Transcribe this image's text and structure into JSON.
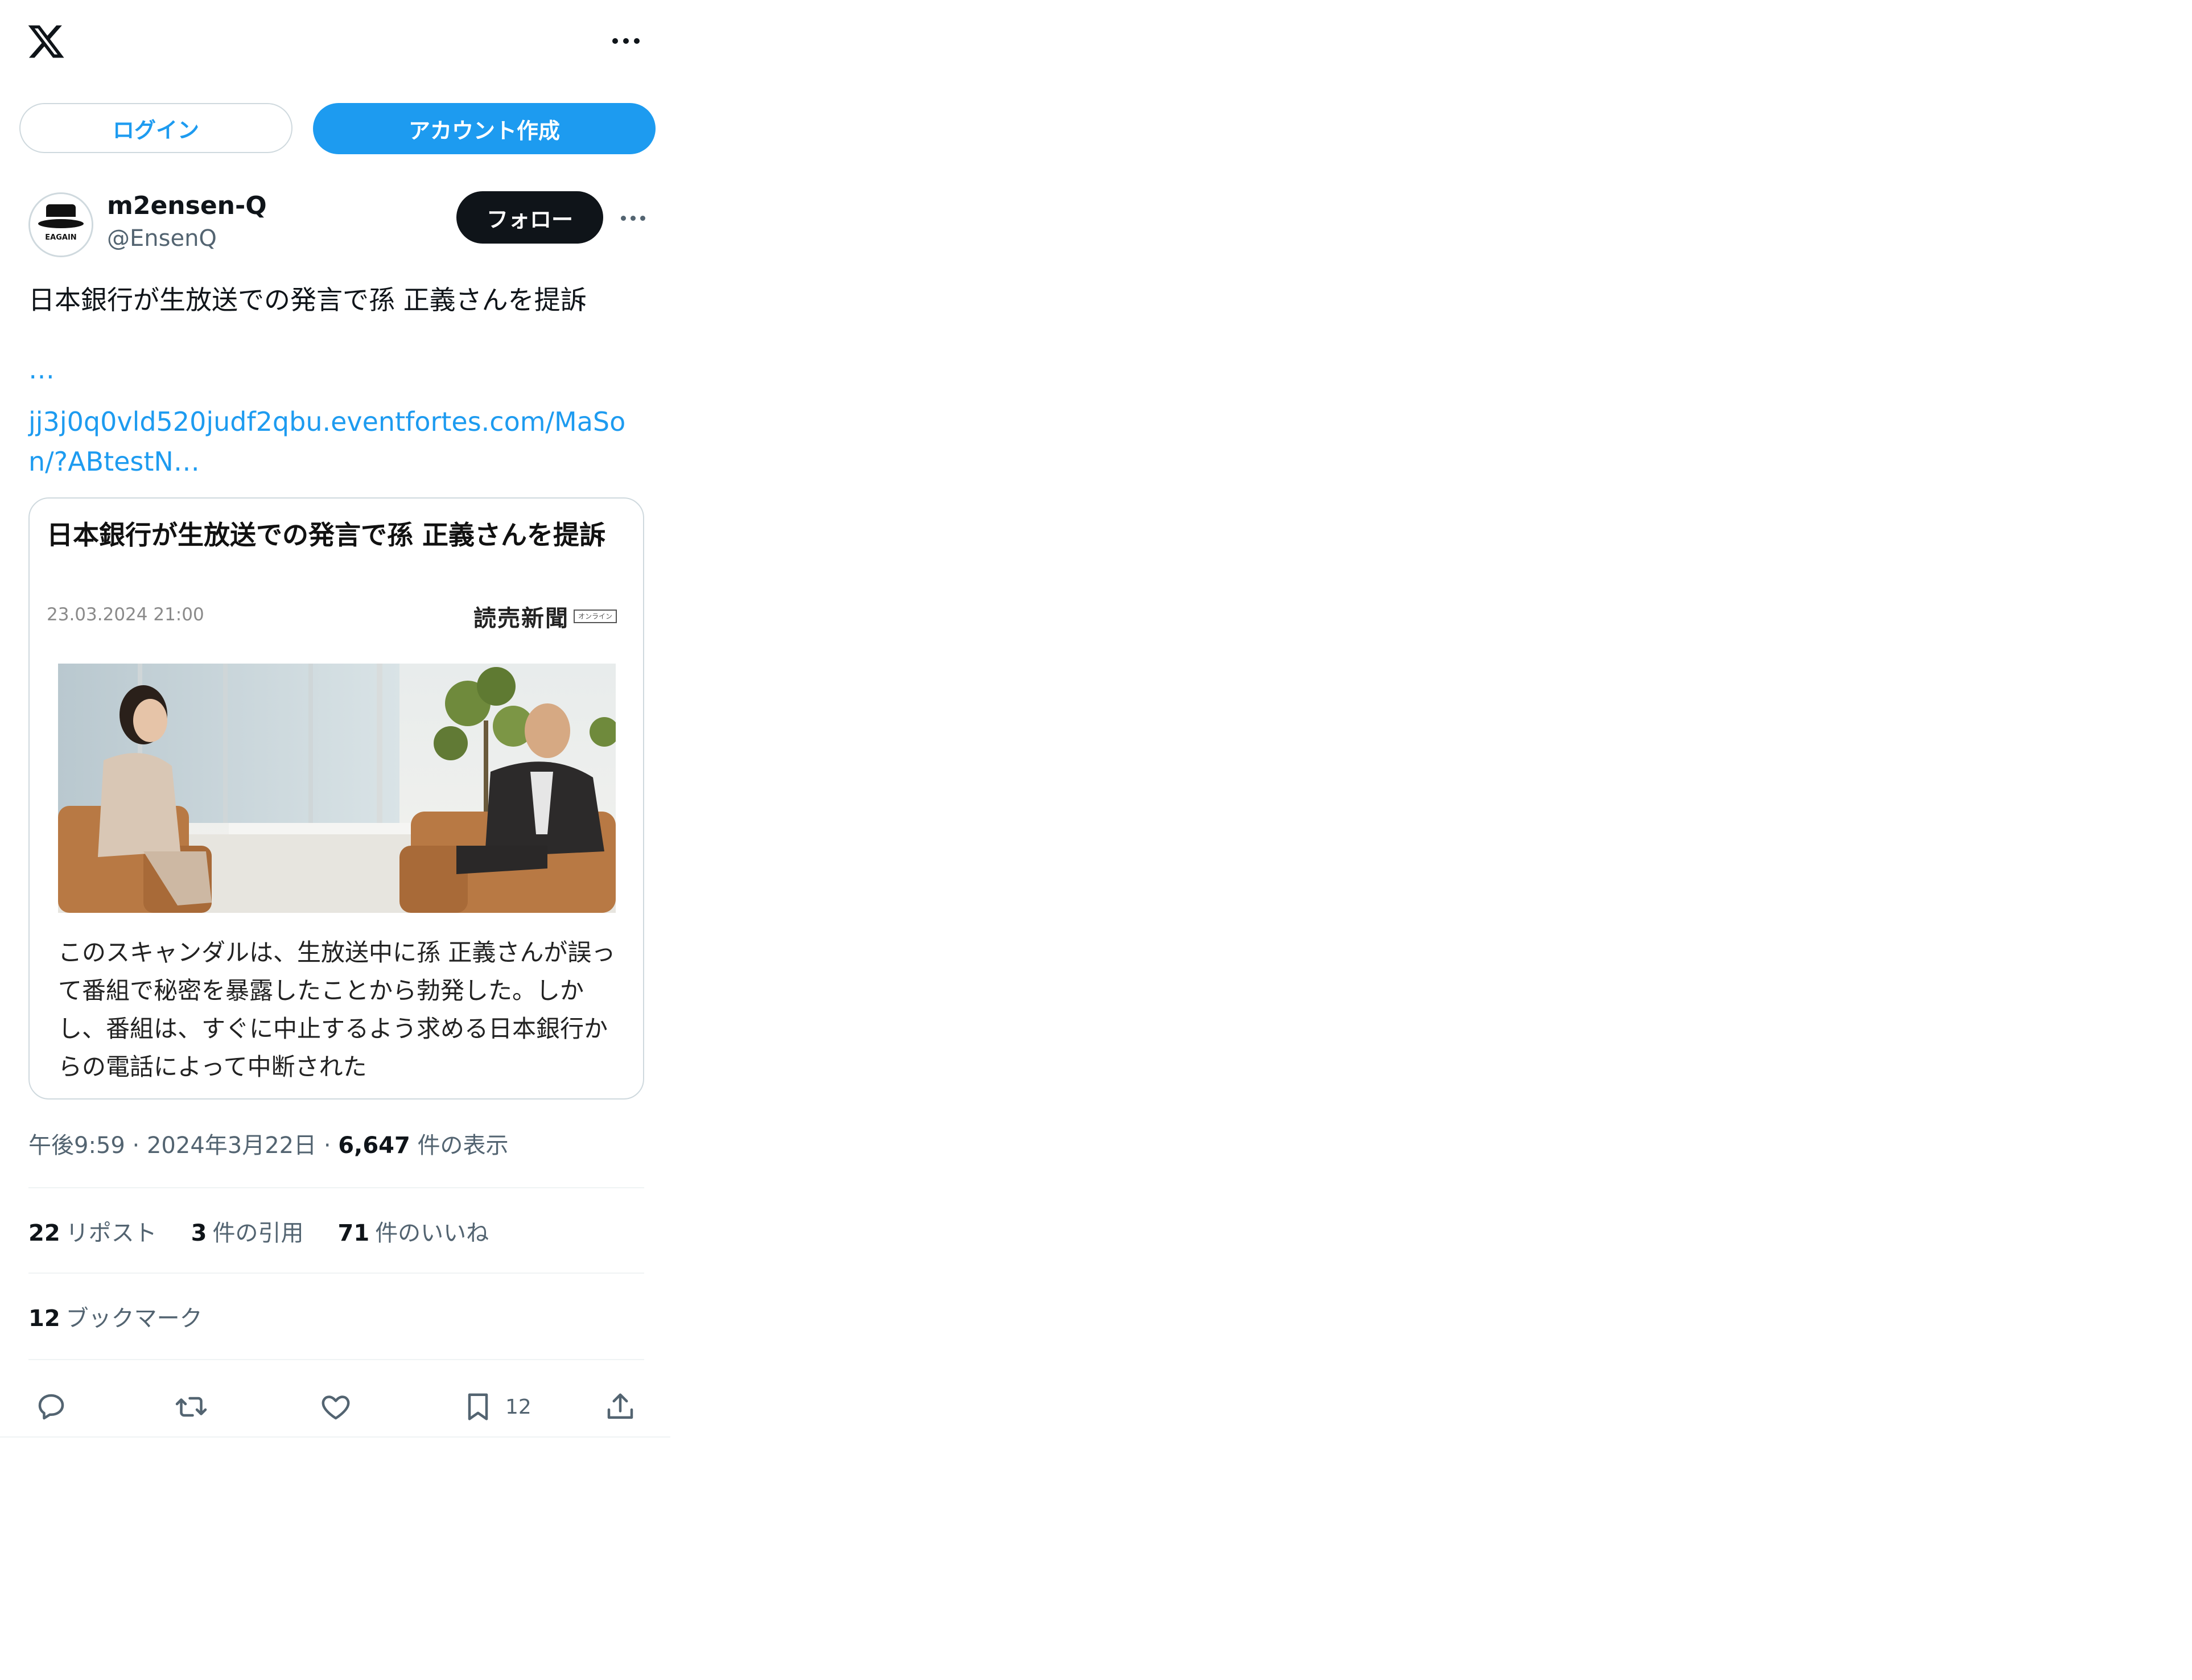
{
  "header": {
    "logo": "x-logo-icon",
    "more": "more-icon"
  },
  "auth": {
    "login_label": "ログイン",
    "signup_label": "アカウント作成"
  },
  "post": {
    "author": {
      "display_name": "m2ensen-Q",
      "handle": "@EnsenQ",
      "avatar_text": "EAGAIN"
    },
    "follow_label": "フォロー",
    "text": "日本銀行が生放送での発言で孫 正義さんを提訴",
    "link_ellipsis": "…",
    "link": "jj3j0q0vld520judf2qbu.eventfortes.com/MaSon/?ABtestN…",
    "card": {
      "title": "日本銀行が生放送での発言で孫 正義さんを提訴",
      "date": "23.03.2024 21:00",
      "source": "読売新聞",
      "source_tag": "オンライン",
      "description": "このスキャンダルは、生放送中に孫 正義さんが誤って番組で秘密を暴露したことから勃発した。しかし、番組は、すぐに中止するよう求める日本銀行からの電話によって中断された"
    },
    "meta": {
      "time": "午後9:59",
      "sep1": " · ",
      "date": "2024年3月22日",
      "sep2": " · ",
      "views_count": "6,647",
      "views_label": " 件の表示"
    },
    "stats": {
      "reposts_count": "22",
      "reposts_label": "リポスト",
      "quotes_count": "3",
      "quotes_label": "件の引用",
      "likes_count": "71",
      "likes_label": "件のいいね",
      "bookmarks_count": "12",
      "bookmarks_label": "ブックマーク"
    },
    "actions": {
      "reply": "reply-icon",
      "repost": "repost-icon",
      "like": "heart-icon",
      "bookmark": "bookmark-icon",
      "bookmark_count": "12",
      "share": "share-icon"
    }
  },
  "colors": {
    "accent": "#1d9bf0",
    "text": "#0f1419",
    "muted": "#536471",
    "border": "#cfd9de"
  }
}
